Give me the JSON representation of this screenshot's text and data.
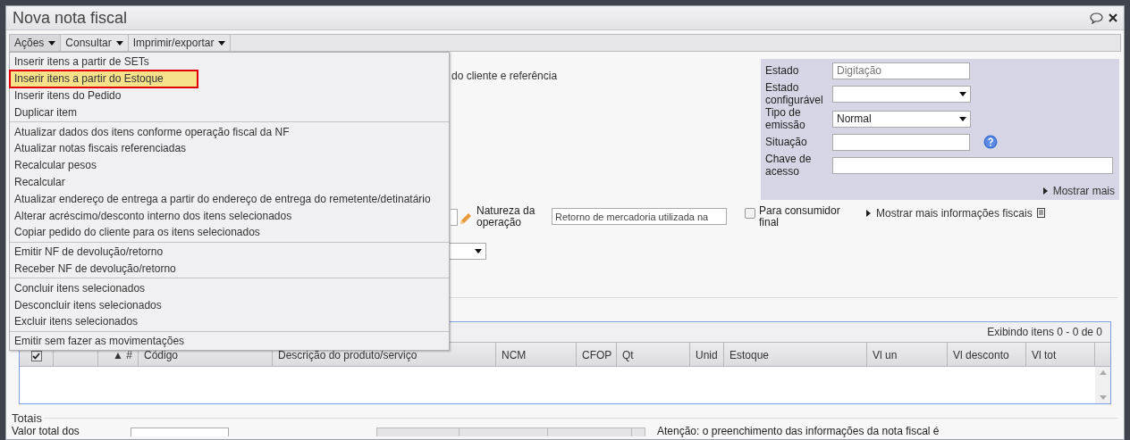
{
  "window": {
    "title": "Nova nota fiscal"
  },
  "toolbar": [
    {
      "label": "Ações",
      "selected": true
    },
    {
      "label": "Consultar",
      "selected": false
    },
    {
      "label": "Imprimir/exportar",
      "selected": false
    }
  ],
  "menu": [
    [
      {
        "label": "Inserir itens a partir de SETs",
        "selected": false,
        "outlined": false
      },
      {
        "label": "Inserir itens a partir do Estoque",
        "selected": true,
        "outlined": true
      },
      {
        "label": "Inserir itens do Pedido",
        "selected": false,
        "outlined": false
      },
      {
        "label": "Duplicar item",
        "selected": false,
        "outlined": false
      }
    ],
    [
      {
        "label": "Atualizar dados dos itens conforme operação fiscal da NF",
        "selected": false,
        "outlined": false
      },
      {
        "label": "Atualizar notas fiscais referenciadas",
        "selected": false,
        "outlined": false
      },
      {
        "label": "Recalcular pesos",
        "selected": false,
        "outlined": false
      },
      {
        "label": "Recalcular",
        "selected": false,
        "outlined": false
      },
      {
        "label": "Atualizar endereço de entrega a partir do endereço de entrega do remetente/detinatário",
        "selected": false,
        "outlined": false
      },
      {
        "label": "Alterar acréscimo/desconto interno dos itens selecionados",
        "selected": false,
        "outlined": false
      },
      {
        "label": "Copiar pedido do cliente para os itens selecionados",
        "selected": false,
        "outlined": false
      }
    ],
    [
      {
        "label": "Emitir NF de devolução/retorno",
        "selected": false,
        "outlined": false
      },
      {
        "label": "Receber NF de devolução/retorno",
        "selected": false,
        "outlined": false
      }
    ],
    [
      {
        "label": "Concluir itens selecionados",
        "selected": false,
        "outlined": false
      },
      {
        "label": "Desconcluir itens selecionados",
        "selected": false,
        "outlined": false
      },
      {
        "label": "Excluir itens selecionados",
        "selected": false,
        "outlined": false
      }
    ],
    [
      {
        "label": "Emitir sem fazer as movimentações",
        "selected": false,
        "outlined": false
      }
    ]
  ],
  "section_heading": "do cliente e referência",
  "status_panel": {
    "fields": [
      {
        "kind": "text",
        "label": "Estado",
        "value": "Digitação",
        "disabled": true
      },
      {
        "kind": "select",
        "label": "Estado configurável"
      },
      {
        "kind": "select",
        "label": "Tipo de emissão",
        "value": "Normal"
      },
      {
        "kind": "text",
        "label": "Situação",
        "help": true
      },
      {
        "kind": "wide",
        "label": "Chave de acesso"
      }
    ],
    "more_link": "Mostrar mais"
  },
  "fiscal_row": {
    "nature_label": "Natureza da operação",
    "nature_value": "Retorno de mercadoria utilizada na",
    "consumer_label": "Para consumidor final",
    "consumer_checked": false,
    "more_link": "Mostrar mais informações fiscais"
  },
  "items": {
    "summary": "Exibindo itens 0 - 0 de 0",
    "select_all_checked": true,
    "columns": [
      "",
      "▲ #",
      "Código",
      "Descrição do produto/serviço",
      "NCM",
      "CFOP",
      "Qt",
      "Unid",
      "Estoque",
      "Vl un",
      "Vl desconto",
      "Vl tot"
    ]
  },
  "totals": {
    "title": "Totais",
    "label": "Valor total dos",
    "notice": "Atenção: o preenchimento das informações da nota fiscal é"
  }
}
